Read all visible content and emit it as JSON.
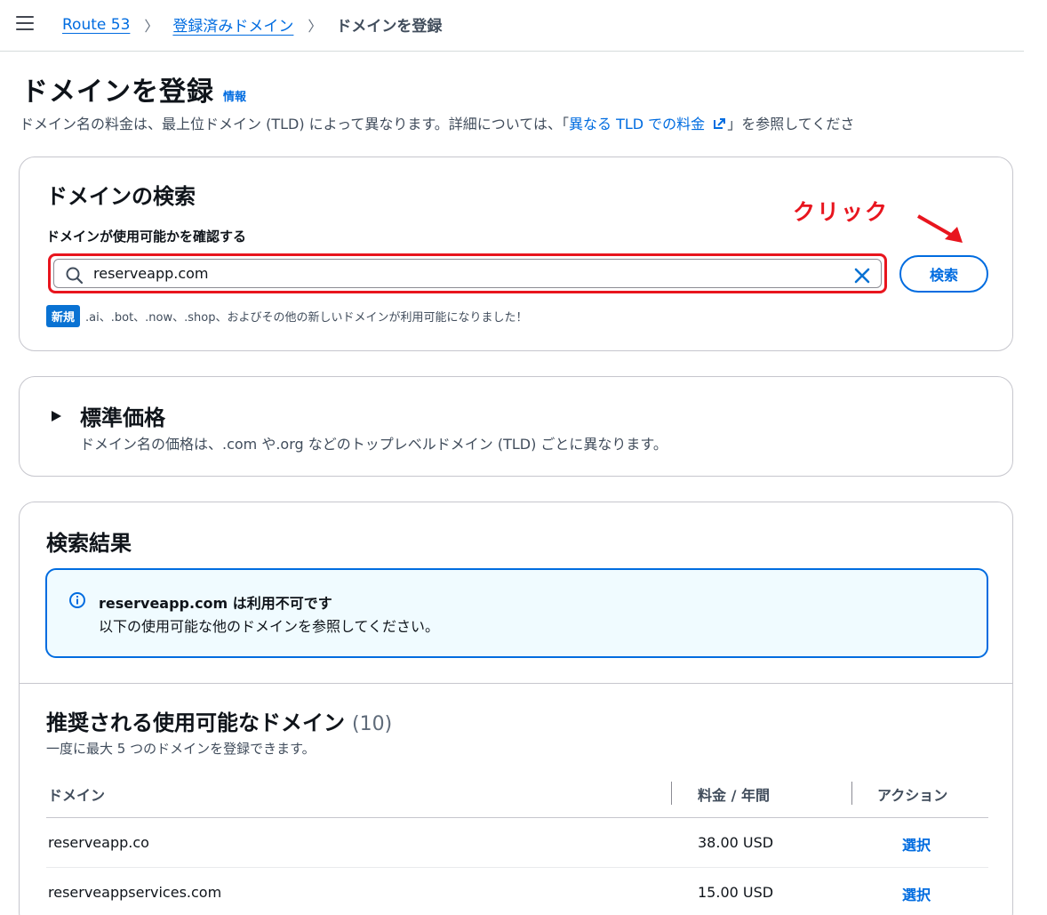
{
  "nav": {
    "breadcrumbs": [
      "Route 53",
      "登録済みドメイン",
      "ドメインを登録"
    ]
  },
  "header": {
    "title": "ドメインを登録",
    "info_link": "情報",
    "desc_prefix": "ドメイン名の料金は、最上位ドメイン (TLD) によって異なります。詳細については、「",
    "desc_link": "異なる TLD での料金",
    "desc_suffix": "」を参照してくださ"
  },
  "search": {
    "title": "ドメインの検索",
    "label": "ドメインが使用可能かを確認する",
    "input_value": "reserveapp.com",
    "button_label": "検索",
    "annotation": "クリック",
    "new_badge": "新規",
    "new_text": ".ai、.bot、.now、.shop、およびその他の新しいドメインが利用可能になりました！"
  },
  "pricing": {
    "title": "標準価格",
    "desc": "ドメイン名の価格は、.com や.org などのトップレベルドメイン (TLD) ごとに異なります。"
  },
  "results": {
    "title": "検索結果",
    "alert_title": "reserveapp.com は利用不可です",
    "alert_body": "以下の使用可能な他のドメインを参照してください。",
    "recommended_title": "推奨される使用可能なドメイン",
    "recommended_count": "(10)",
    "recommended_sub": "一度に最大 5 つのドメインを登録できます。",
    "columns": [
      "ドメイン",
      "料金 / 年間",
      "アクション"
    ],
    "rows": [
      {
        "domain": "reserveapp.co",
        "price": "38.00 USD",
        "action": "選択"
      },
      {
        "domain": "reserveappservices.com",
        "price": "15.00 USD",
        "action": "選択"
      }
    ]
  },
  "colors": {
    "link": "#006ce0",
    "highlight": "#e8151e",
    "alert_bg": "#f0fbff",
    "badge": "#0972d3"
  },
  "icons": [
    "menu-icon",
    "chevron-right-icon",
    "external-link-icon",
    "search-icon",
    "close-icon",
    "caret-right-icon",
    "info-icon",
    "arrow-down-right-icon"
  ]
}
